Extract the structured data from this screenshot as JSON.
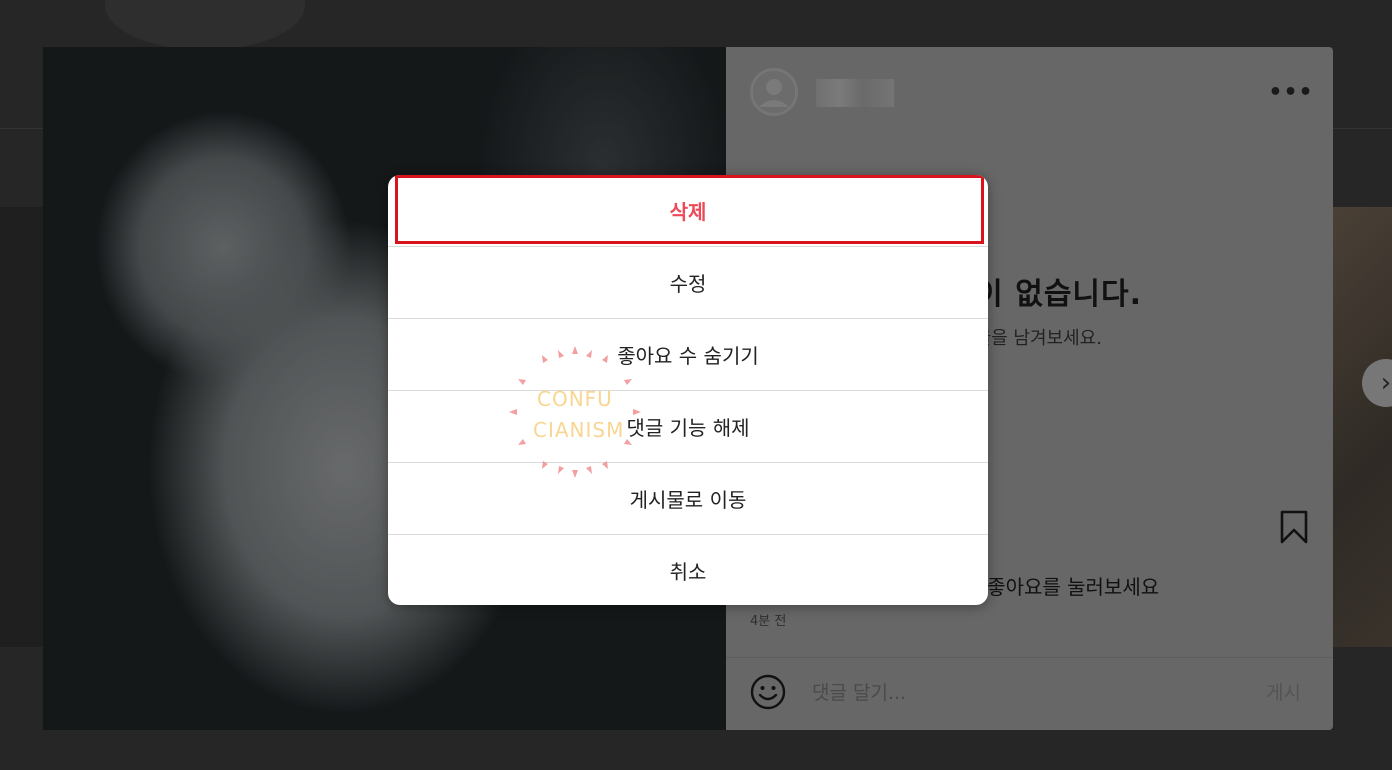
{
  "post": {
    "empty_title": "댓글이 없습니다.",
    "empty_subtitle": "댓글을 남겨보세요.",
    "like_prompt": "가장 먼저 좋아요를 눌러보세요",
    "timestamp": "4분 전",
    "comment_placeholder": "댓글 달기...",
    "post_button": "게시",
    "more_icon": "more-horizontal-icon",
    "bookmark_icon": "bookmark-icon",
    "emoji_icon": "smiley-icon"
  },
  "dialog": {
    "items": [
      {
        "label": "삭제",
        "style": "danger",
        "color": "#ed4956"
      },
      {
        "label": "수정"
      },
      {
        "label": "좋아요 수 숨기기"
      },
      {
        "label": "댓글 기능 해제"
      },
      {
        "label": "게시물로 이동"
      },
      {
        "label": "취소"
      }
    ],
    "highlight_color": "#d8131b"
  },
  "watermark": {
    "line1": "CONFU",
    "line2": "CIANISM"
  },
  "navigation": {
    "next_icon": "chevron-right-icon"
  }
}
